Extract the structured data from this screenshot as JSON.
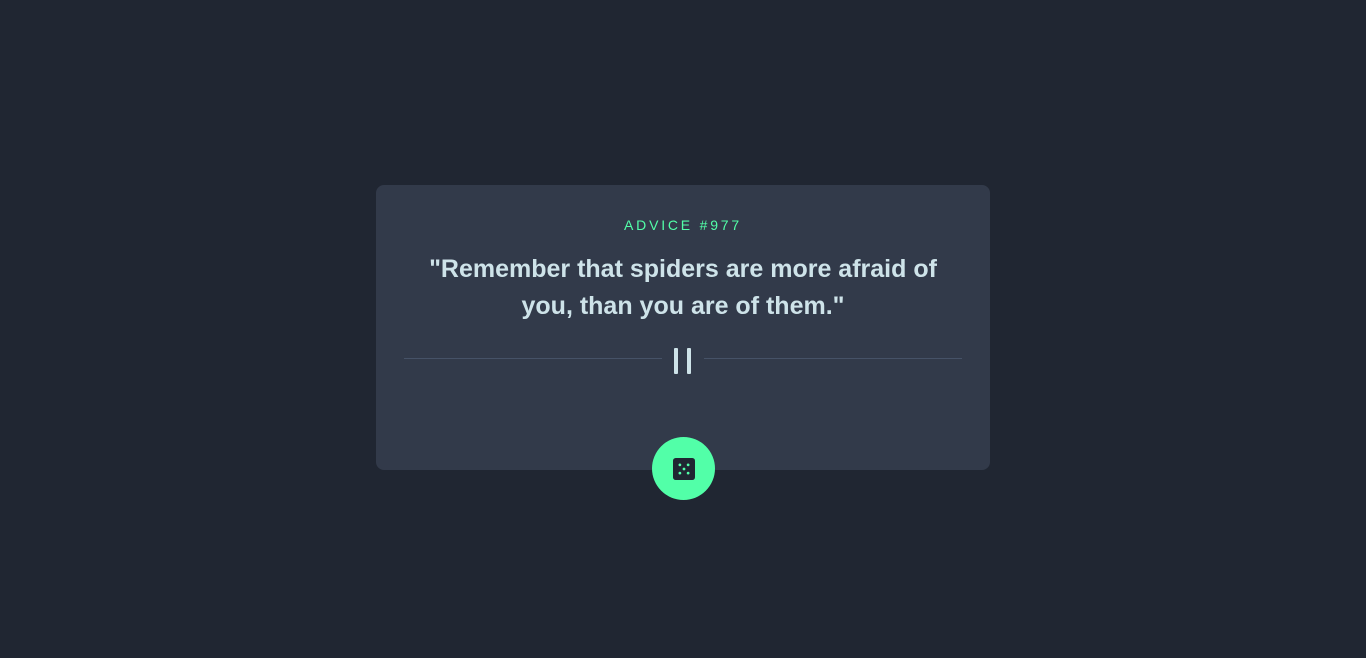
{
  "advice": {
    "label": "ADVICE #977",
    "text": "\"Remember that spiders are more afraid of you, than you are of them.\""
  },
  "icons": {
    "divider": "pause-icon",
    "button": "dice-icon"
  },
  "colors": {
    "background": "#202632",
    "card": "#323a4a",
    "accent": "#52ffa8",
    "text": "#cee3e9",
    "divider": "#4f5d74"
  }
}
